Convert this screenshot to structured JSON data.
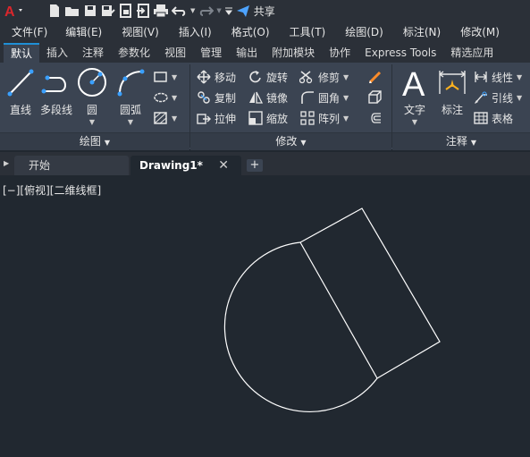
{
  "quick_access": {
    "share_label": "共享",
    "icons": [
      "new-file-icon",
      "open-folder-icon",
      "save-icon",
      "save-as-icon",
      "publish-icon",
      "import-icon",
      "print-icon",
      "undo-icon",
      "redo-icon",
      "customize-icon",
      "share-icon"
    ]
  },
  "menu": {
    "items": [
      "文件(F)",
      "编辑(E)",
      "视图(V)",
      "插入(I)",
      "格式(O)",
      "工具(T)",
      "绘图(D)",
      "标注(N)",
      "修改(M)"
    ]
  },
  "ribbon_tabs": {
    "items": [
      "默认",
      "插入",
      "注释",
      "参数化",
      "视图",
      "管理",
      "输出",
      "附加模块",
      "协作",
      "Express Tools",
      "精选应用"
    ],
    "active": "默认"
  },
  "draw_panel": {
    "title": "绘图",
    "line": "直线",
    "polyline": "多段线",
    "circle": "圆",
    "arc": "圆弧"
  },
  "modify_panel": {
    "title": "修改",
    "move": "移动",
    "rotate": "旋转",
    "trim": "修剪",
    "copy": "复制",
    "mirror": "镜像",
    "fillet": "圆角",
    "stretch": "拉伸",
    "scale": "缩放",
    "array": "阵列"
  },
  "annotation_panel": {
    "title": "注释",
    "text": "文字",
    "dimension": "标注",
    "linear": "线性",
    "leader": "引线",
    "table": "表格"
  },
  "file_tabs": {
    "start": "开始",
    "drawing": "Drawing1*"
  },
  "viewport": {
    "label": "[−][俯视][二维线框]"
  },
  "colors": {
    "background": "#212830",
    "ribbon": "#3b4452",
    "accent": "#1f8fd6",
    "logo_red": "#d9262c"
  }
}
